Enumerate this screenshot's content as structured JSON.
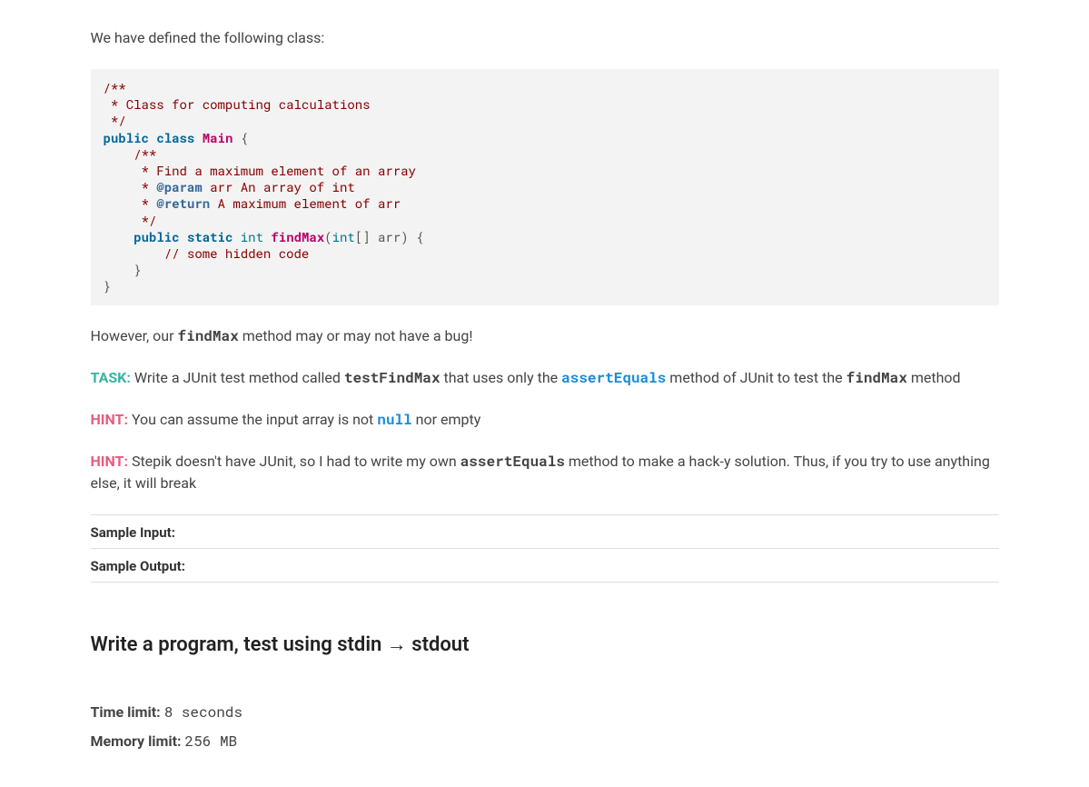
{
  "intro_text": "We have defined the following class:",
  "code": {
    "t01": "/**",
    "t02": " * Class for computing calculations",
    "t03": " */",
    "t04a": "public",
    "t04b": "class",
    "t04c": "Main",
    "t04d": " {",
    "t05": "    /**",
    "t06": "     * Find a maximum element of an array",
    "t07a": "     * ",
    "t07b": "@param",
    "t07c": " arr An array of int",
    "t08a": "     * ",
    "t08b": "@return",
    "t08c": " A maximum element of arr",
    "t09": "     */",
    "t10a": "    ",
    "t10b": "public",
    "t10c": "static",
    "t10d": "int",
    "t10e": "findMax",
    "t10f": "(",
    "t10g": "int",
    "t10h": "[] arr) {",
    "t11": "        // some hidden code",
    "t12": "    }",
    "t13": "}"
  },
  "p_however": {
    "pre": "However, our ",
    "code": "findMax",
    "post": " method may or may not have a bug!"
  },
  "p_task": {
    "label": "TASK:",
    "t1": " Write a JUnit test method called ",
    "c1": "testFindMax",
    "t2": " that uses only the ",
    "c2": "assertEquals",
    "t3": " method of JUnit to test the ",
    "c3": "findMax",
    "t4": " method"
  },
  "p_hint1": {
    "label": "HINT:",
    "t1": " You can assume the input array is not ",
    "c1": "null",
    "t2": " nor empty"
  },
  "p_hint2": {
    "label": "HINT:",
    "t1": " Stepik doesn't have JUnit, so I had to write my own ",
    "c1": "assertEquals",
    "t2": " method to make a hack-y solution. Thus, if you try to use anything else, it will break"
  },
  "sample_input_label": "Sample Input:",
  "sample_output_label": "Sample Output:",
  "section_heading": "Write a program, test using stdin → stdout",
  "limits": {
    "time_label": "Time limit: ",
    "time_value": "8 seconds",
    "memory_label": "Memory limit: ",
    "memory_value": "256 MB"
  }
}
